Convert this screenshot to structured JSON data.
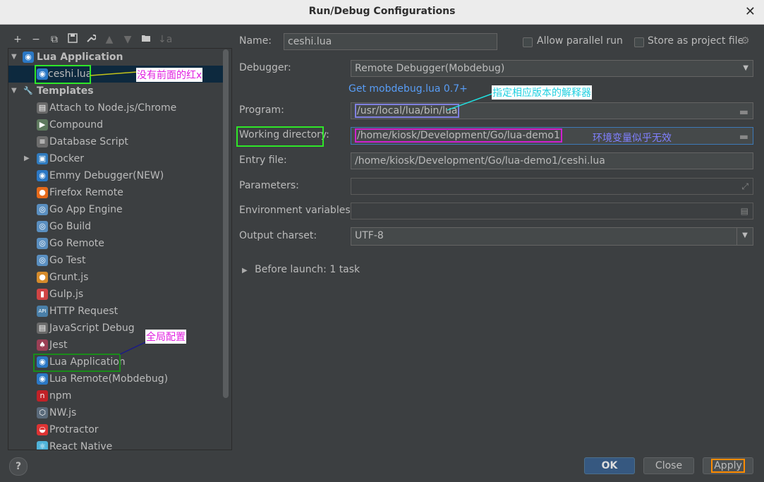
{
  "window": {
    "title": "Run/Debug Configurations",
    "close": "✕"
  },
  "toolbar": {
    "add": "+",
    "remove": "−",
    "copy": "⧉",
    "save": "💾",
    "edit": "🔧",
    "up": "▲",
    "down": "▼",
    "folder": "📁",
    "sort": "↓a"
  },
  "tree": {
    "lua_app_header": "Lua Application",
    "ceshi": "ceshi.lua",
    "templates_header": "Templates",
    "items": [
      {
        "label": "Attach to Node.js/Chrome",
        "icon": "node-attach-icon",
        "glyph": "▤",
        "color": "#6a6a6a"
      },
      {
        "label": "Compound",
        "icon": "compound-icon",
        "glyph": "▶",
        "color": "#5e7a5e"
      },
      {
        "label": "Database Script",
        "icon": "database-icon",
        "glyph": "≡",
        "color": "#6d6d6d"
      },
      {
        "label": "Docker",
        "icon": "docker-icon",
        "glyph": "▣",
        "color": "#2f7bbf",
        "arrow": true
      },
      {
        "label": "Emmy Debugger(NEW)",
        "icon": "emmy-debugger-icon",
        "glyph": "◉",
        "color": "#2b78c5"
      },
      {
        "label": "Firefox Remote",
        "icon": "firefox-icon",
        "glyph": "●",
        "color": "#e66a1a"
      },
      {
        "label": "Go App Engine",
        "icon": "go-app-engine-icon",
        "glyph": "◎",
        "color": "#5a8fc0"
      },
      {
        "label": "Go Build",
        "icon": "go-build-icon",
        "glyph": "◎",
        "color": "#5a8fc0"
      },
      {
        "label": "Go Remote",
        "icon": "go-remote-icon",
        "glyph": "◎",
        "color": "#5a8fc0"
      },
      {
        "label": "Go Test",
        "icon": "go-test-icon",
        "glyph": "◎",
        "color": "#5a8fc0"
      },
      {
        "label": "Grunt.js",
        "icon": "grunt-icon",
        "glyph": "●",
        "color": "#d58b2b"
      },
      {
        "label": "Gulp.js",
        "icon": "gulp-icon",
        "glyph": "▮",
        "color": "#d04444"
      },
      {
        "label": "HTTP Request",
        "icon": "http-request-icon",
        "glyph": "API",
        "color": "#4a7fa8"
      },
      {
        "label": "JavaScript Debug",
        "icon": "js-debug-icon",
        "glyph": "▤",
        "color": "#6a6a6a"
      },
      {
        "label": "Jest",
        "icon": "jest-icon",
        "glyph": "♠",
        "color": "#9b3f55"
      },
      {
        "label": "Lua Application",
        "icon": "lua-app-icon",
        "glyph": "◉",
        "color": "#2b78c5"
      },
      {
        "label": "Lua Remote(Mobdebug)",
        "icon": "lua-remote-icon",
        "glyph": "◉",
        "color": "#2b78c5"
      },
      {
        "label": "npm",
        "icon": "npm-icon",
        "glyph": "n",
        "color": "#c12127"
      },
      {
        "label": "NW.js",
        "icon": "nwjs-icon",
        "glyph": "⬡",
        "color": "#5a6a7a"
      },
      {
        "label": "Protractor",
        "icon": "protractor-icon",
        "glyph": "◒",
        "color": "#d33"
      },
      {
        "label": "React Native",
        "icon": "react-native-icon",
        "glyph": "⚛",
        "color": "#4fb3d9"
      }
    ]
  },
  "form": {
    "name_label": "Name:",
    "name_value": "ceshi.lua",
    "allow_parallel": "Allow parallel run",
    "store_project": "Store as project file",
    "debugger_label": "Debugger:",
    "debugger_value": "Remote Debugger(Mobdebug)",
    "get_link": "Get mobdebug.lua 0.7+",
    "program_label": "Program:",
    "program_value": "/usr/local/lua/bin/lua",
    "workdir_label": "Working directory:",
    "workdir_value": "/home/kiosk/Development/Go/lua-demo1",
    "entry_label": "Entry file:",
    "entry_value": "/home/kiosk/Development/Go/lua-demo1/ceshi.lua",
    "params_label": "Parameters:",
    "params_value": "",
    "env_label": "Environment variables:",
    "env_value": "",
    "charset_label": "Output charset:",
    "charset_value": "UTF-8",
    "before_launch": "Before launch: 1 task"
  },
  "annotations": {
    "no_red_x": "没有前面的红x",
    "specify_interp": "指定相应版本的解释器",
    "env_invalid": "环境变量似乎无效",
    "global_config": "全局配置"
  },
  "buttons": {
    "ok": "OK",
    "close": "Close",
    "apply": "Apply",
    "help": "?"
  }
}
